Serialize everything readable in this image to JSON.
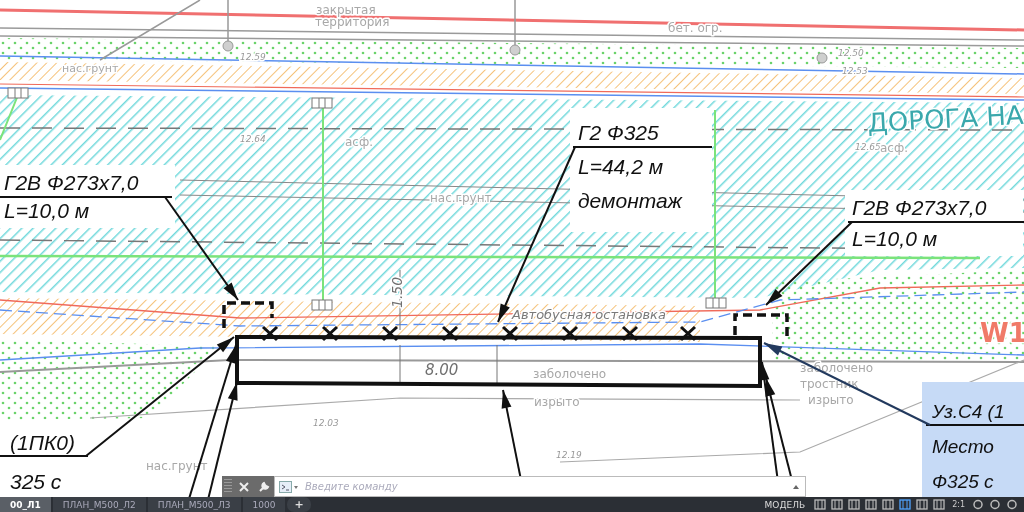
{
  "drawing": {
    "labels": [
      {
        "text": "закрытая",
        "kind": "area"
      },
      {
        "text": "территория",
        "kind": "area"
      },
      {
        "text": "бет. огр.",
        "kind": "area"
      },
      {
        "text": "нас.грунт",
        "kind": "area"
      },
      {
        "text": "12.59",
        "kind": "elevation"
      },
      {
        "text": "12.50",
        "kind": "elevation"
      },
      {
        "text": "12.53",
        "kind": "elevation"
      },
      {
        "text": "12.64",
        "kind": "elevation"
      },
      {
        "text": "асф.",
        "kind": "area"
      },
      {
        "text": "12.65",
        "kind": "elevation"
      },
      {
        "text": "ДОРОГА НА",
        "kind": "road"
      },
      {
        "text": "асф.",
        "kind": "area"
      },
      {
        "text": "нас.грунт",
        "kind": "area"
      },
      {
        "text": "1.50",
        "kind": "dimension"
      },
      {
        "text": "Автобусная остановка",
        "kind": "stop"
      },
      {
        "text": "8.00",
        "kind": "dimension"
      },
      {
        "text": "W1",
        "kind": "marker"
      },
      {
        "text": "заболочено",
        "kind": "area"
      },
      {
        "text": "изрыто",
        "kind": "area"
      },
      {
        "text": "заболочено",
        "kind": "area"
      },
      {
        "text": "тростник",
        "kind": "area"
      },
      {
        "text": "изрыто",
        "kind": "area"
      },
      {
        "text": "12.03",
        "kind": "elevation"
      },
      {
        "text": "12.19",
        "kind": "elevation"
      },
      {
        "text": "нас.грунт",
        "kind": "area"
      }
    ],
    "callouts": [
      {
        "lines": [
          "Г2В Ф273х7,0",
          "L=10,0 м"
        ],
        "selected": false
      },
      {
        "lines": [
          "Г2 Ф325",
          "L=44,2 м",
          "демонтаж"
        ],
        "selected": false
      },
      {
        "lines": [
          "Г2В Ф273х7,0",
          "L=10,0 м"
        ],
        "selected": false
      },
      {
        "lines": [
          "(1ПК0)"
        ]
      },
      {
        "lines": [
          "325 с"
        ]
      },
      {
        "lines": [
          "Уз.С4 (1",
          "Место",
          "Ф325 с"
        ],
        "selected": true
      }
    ]
  },
  "command_line": {
    "placeholder": "Введите команду"
  },
  "layout_tabs": [
    {
      "label": "00_Л1",
      "selected": true
    },
    {
      "label": "ПЛАН_М500_Л2",
      "selected": false
    },
    {
      "label": "ПЛАН_М500_Л3",
      "selected": false
    },
    {
      "label": "1000",
      "selected": false
    }
  ],
  "add_tab": "+",
  "status_bar": {
    "model": "МОДЕЛЬ",
    "scale": "2:1"
  }
}
